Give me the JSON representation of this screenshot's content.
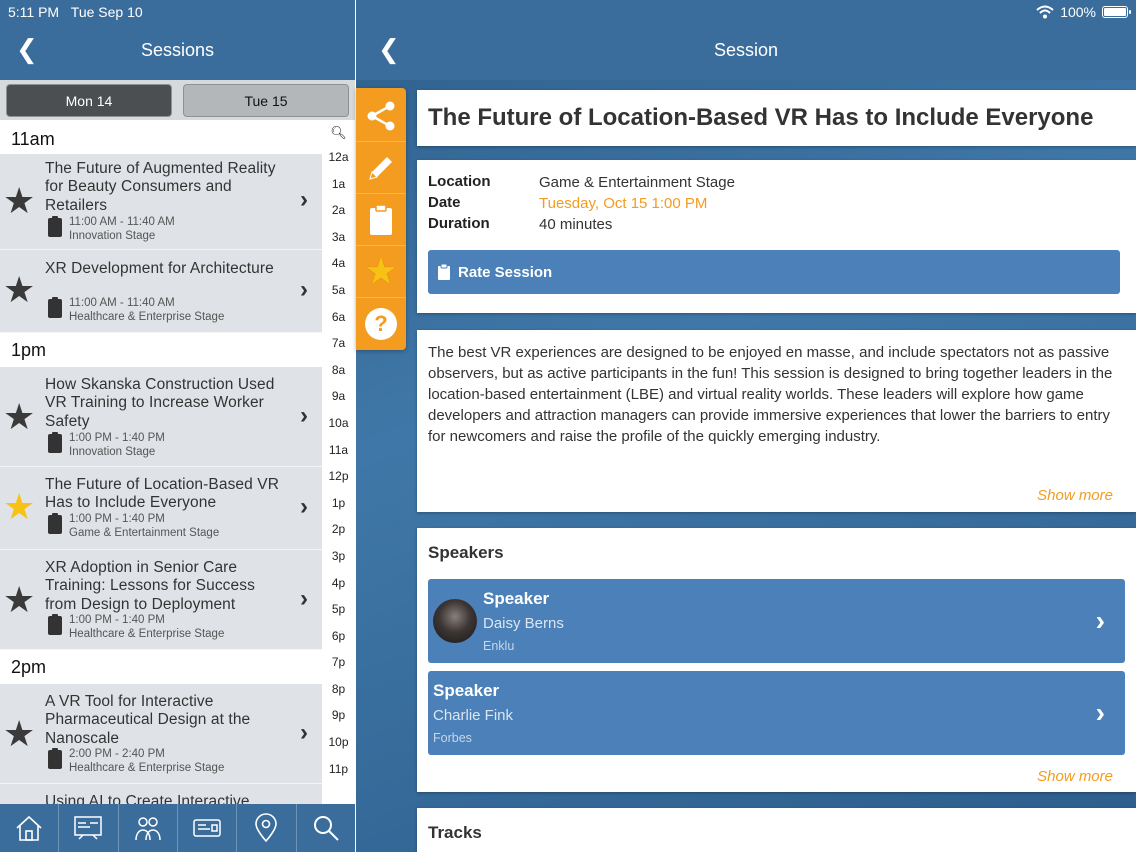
{
  "status": {
    "time": "5:11 PM",
    "date": "Tue Sep 10",
    "battery": "100%"
  },
  "left": {
    "title": "Sessions",
    "days": [
      "Mon 14",
      "Tue 15"
    ],
    "groups": [
      {
        "hour": "11am",
        "sessions": [
          {
            "title": "The Future of Augmented Reality for Beauty Consumers and Retailers",
            "time": "11:00 AM - 11:40 AM",
            "stage": "Innovation Stage",
            "favorite": false
          },
          {
            "title": "XR Development for Architecture",
            "time": "11:00 AM - 11:40 AM",
            "stage": "Healthcare & Enterprise Stage",
            "favorite": false
          }
        ]
      },
      {
        "hour": "1pm",
        "sessions": [
          {
            "title": "How Skanska Construction Used VR Training to Increase Worker Safety",
            "time": "1:00 PM - 1:40 PM",
            "stage": "Innovation Stage",
            "favorite": false
          },
          {
            "title": "The Future of Location-Based VR Has to Include Everyone",
            "time": "1:00 PM - 1:40 PM",
            "stage": "Game & Entertainment Stage",
            "favorite": true
          },
          {
            "title": "XR Adoption in Senior Care Training: Lessons for Success from Design to Deployment",
            "time": "1:00 PM - 1:40 PM",
            "stage": "Healthcare & Enterprise Stage",
            "favorite": false
          }
        ]
      },
      {
        "hour": "2pm",
        "sessions": [
          {
            "title": "A VR Tool for Interactive Pharmaceutical Design at the Nanoscale",
            "time": "2:00 PM - 2:40 PM",
            "stage": "Healthcare & Enterprise Stage",
            "favorite": false
          },
          {
            "title": "Using AI to Create Interactive",
            "time": "",
            "stage": "",
            "favorite": false
          }
        ]
      }
    ],
    "index": [
      "12a",
      "1a",
      "2a",
      "3a",
      "4a",
      "5a",
      "6a",
      "7a",
      "8a",
      "9a",
      "10a",
      "11a",
      "12p",
      "1p",
      "2p",
      "3p",
      "4p",
      "5p",
      "6p",
      "7p",
      "8p",
      "9p",
      "10p",
      "11p"
    ],
    "tabs": [
      "home-icon",
      "schedule-icon",
      "people-icon",
      "ticket-icon",
      "map-pin-icon",
      "search-icon"
    ]
  },
  "right": {
    "title": "Session",
    "session_title": "The Future of Location-Based VR Has to Include Everyone",
    "location_label": "Location",
    "location": "Game & Entertainment Stage",
    "date_label": "Date",
    "date": "Tuesday, Oct 15 1:00 PM",
    "duration_label": "Duration",
    "duration": "40 minutes",
    "rate_label": "Rate Session",
    "description": "The best VR experiences are designed to be enjoyed en masse, and include spectators not as passive observers, but as active participants in the fun! This session is designed to bring together leaders in the location-based entertainment (LBE) and virtual reality worlds. These leaders will explore how game developers and attraction managers can provide immersive experiences that lower the barriers to entry for newcomers and raise the profile of the quickly emerging industry.",
    "show_more": "Show more",
    "speakers_heading": "Speakers",
    "speakers": [
      {
        "role": "Speaker",
        "name": "Daisy Berns",
        "org": "Enklu"
      },
      {
        "role": "Speaker",
        "name": "Charlie Fink",
        "org": "Forbes"
      }
    ],
    "tracks_heading": "Tracks",
    "colors": {
      "nav": "#3b6d9c",
      "accent": "#f39c1f",
      "button": "#4b80b8"
    }
  }
}
